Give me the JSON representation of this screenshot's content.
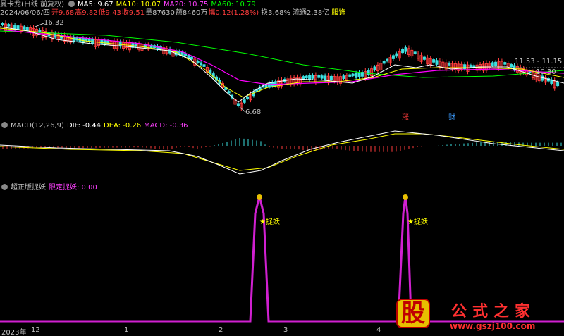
{
  "header": {
    "stock_name": "曼卡龙(日线 前复权)",
    "ma5": "MA5: 9.67",
    "ma10": "MA10: 10.07",
    "ma20": "MA20: 10.75",
    "ma60": "MA60: 10.79",
    "info_date": "2024/06/06/四",
    "info_open": "开9.68",
    "info_high": "高9.82",
    "info_low": "低9.43",
    "info_close": "收9.51",
    "info_volume": "量87630",
    "info_amount": "额8460万",
    "info_change": "幅0.12(1.28%)",
    "info_turnover": "换3.68%",
    "info_float": "流通2.38亿",
    "info_industry": "服饰"
  },
  "price_panel": {
    "high_mark": "16.32",
    "low_mark": "6.68",
    "range_label": "11.53 - 11.15",
    "price_level": "10.30",
    "tag_zhang": "涨",
    "tag_cai": "财"
  },
  "macd_panel": {
    "title": "MACD(12,26,9)",
    "dif": "DIF: -0.44",
    "dea": "DEA: -0.26",
    "macd": "MACD: -0.36"
  },
  "indicator_panel": {
    "title": "超正版捉妖",
    "limit_label": "限定捉妖: 0.00",
    "signal_1": "捉妖",
    "signal_2": "捉妖"
  },
  "time_axis": {
    "labels": [
      "2023年",
      "12",
      "1",
      "2",
      "3",
      "4"
    ]
  },
  "watermark": {
    "char": "股",
    "title": "公式之家",
    "url": "www.gszj100.com"
  },
  "colors": {
    "up": "#ff3c3c",
    "down": "#3ce0e0",
    "ma5": "#ffffff",
    "ma10": "#ffff00",
    "ma20": "#ff00ff",
    "ma60": "#00ff00",
    "indicator": "#d020d0"
  }
}
